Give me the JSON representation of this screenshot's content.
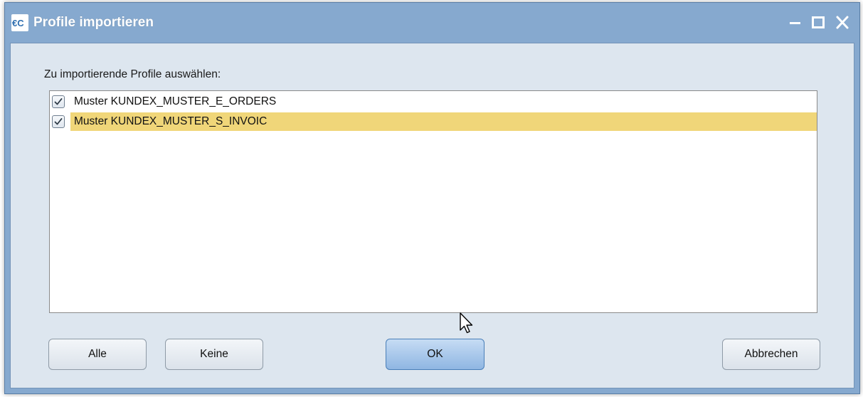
{
  "window": {
    "title": "Profile importieren",
    "controls": [
      "minimize-icon",
      "maximize-icon",
      "close-icon"
    ]
  },
  "prompt": "Zu importierende Profile auswählen:",
  "profiles": [
    {
      "label": "Muster KUNDEX_MUSTER_E_ORDERS",
      "checked": true,
      "selected": false
    },
    {
      "label": "Muster KUNDEX_MUSTER_S_INVOIC",
      "checked": true,
      "selected": true
    }
  ],
  "buttons": {
    "all": "Alle",
    "none": "Keine",
    "ok": "OK",
    "cancel": "Abbrechen"
  },
  "colors": {
    "titlebar": "#86a9cf",
    "client_bg": "#dde6ef",
    "selection": "#f0d679",
    "ok_button": "#a9c8ec"
  }
}
